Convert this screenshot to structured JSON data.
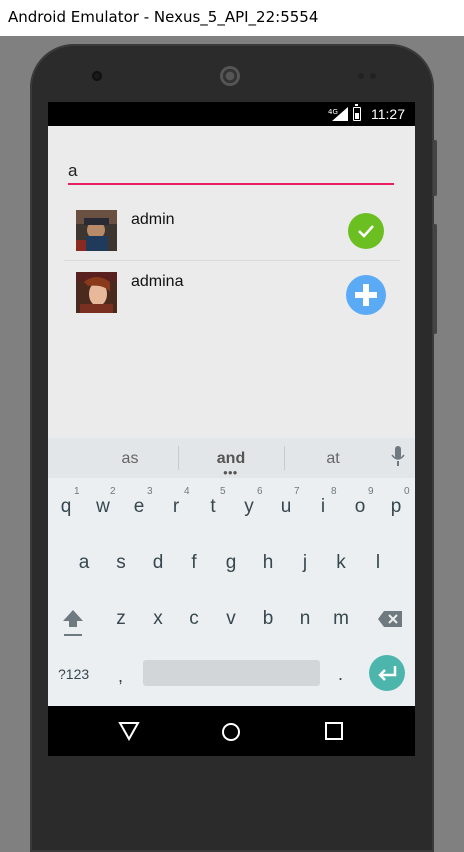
{
  "window": {
    "title": "Android Emulator - Nexus_5_API_22:5554"
  },
  "status_bar": {
    "network": "4G",
    "time": "11:27"
  },
  "search": {
    "value": "a",
    "accent_color": "#e91e63"
  },
  "users": [
    {
      "name": "admin",
      "status": "added",
      "status_icon": "check-circle-icon",
      "status_color": "#6cbf20"
    },
    {
      "name": "admina",
      "status": "not-added",
      "status_icon": "plus-circle-icon",
      "status_color": "#5aaaf5"
    }
  ],
  "keyboard": {
    "suggestions": [
      "as",
      "and",
      "at"
    ],
    "rows": [
      [
        "q",
        "w",
        "e",
        "r",
        "t",
        "y",
        "u",
        "i",
        "o",
        "p"
      ],
      [
        "a",
        "s",
        "d",
        "f",
        "g",
        "h",
        "j",
        "k",
        "l"
      ],
      [
        "z",
        "x",
        "c",
        "v",
        "b",
        "n",
        "m"
      ]
    ],
    "number_hints": [
      "1",
      "2",
      "3",
      "4",
      "5",
      "6",
      "7",
      "8",
      "9",
      "0"
    ],
    "symbols_key": "?123",
    "comma_key": ",",
    "period_key": ".",
    "enter_color": "#4db6ac"
  },
  "nav_bar": {
    "icons": [
      "back-icon",
      "home-icon",
      "recents-icon"
    ]
  }
}
